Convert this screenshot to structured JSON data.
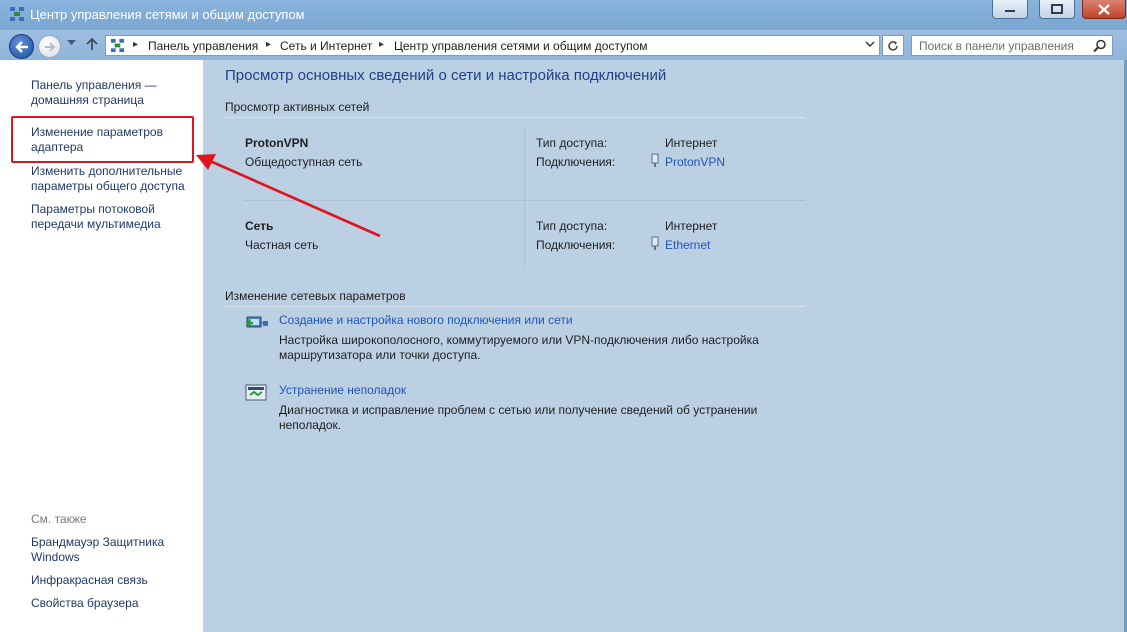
{
  "window": {
    "title": "Центр управления сетями и общим доступом"
  },
  "address_bar": {
    "crumbs": [
      "Панель управления",
      "Сеть и Интернет",
      "Центр управления сетями и общим доступом"
    ],
    "search_placeholder": "Поиск в панели управления"
  },
  "sidebar": {
    "home_link": "Панель управления — домашняя страница",
    "links": [
      "Изменение параметров адаптера",
      "Изменить дополнительные параметры общего доступа",
      "Параметры потоковой передачи мультимедиа"
    ],
    "see_also_title": "См. также",
    "see_also": [
      "Брандмауэр Защитника Windows",
      "Инфракрасная связь",
      "Свойства браузера"
    ]
  },
  "main": {
    "title": "Просмотр основных сведений о сети и настройка подключений",
    "active_networks_heading": "Просмотр активных сетей",
    "networks": [
      {
        "name": "ProtonVPN",
        "category": "Общедоступная сеть",
        "access_label": "Тип доступа:",
        "access_value": "Интернет",
        "connections_label": "Подключения:",
        "connection": "ProtonVPN"
      },
      {
        "name": "Сеть",
        "category": "Частная сеть",
        "access_label": "Тип доступа:",
        "access_value": "Интернет",
        "connections_label": "Подключения:",
        "connection": "Ethernet"
      }
    ],
    "change_settings_heading": "Изменение сетевых параметров",
    "tasks": [
      {
        "link": "Создание и настройка нового подключения или сети",
        "description": "Настройка широкополосного, коммутируемого или VPN-подключения либо настройка маршрутизатора или точки доступа."
      },
      {
        "link": "Устранение неполадок",
        "description": "Диагностика и исправление проблем с сетью или получение сведений об устранении неполадок."
      }
    ]
  },
  "annotation": {
    "highlight_color": "#e0141e"
  }
}
